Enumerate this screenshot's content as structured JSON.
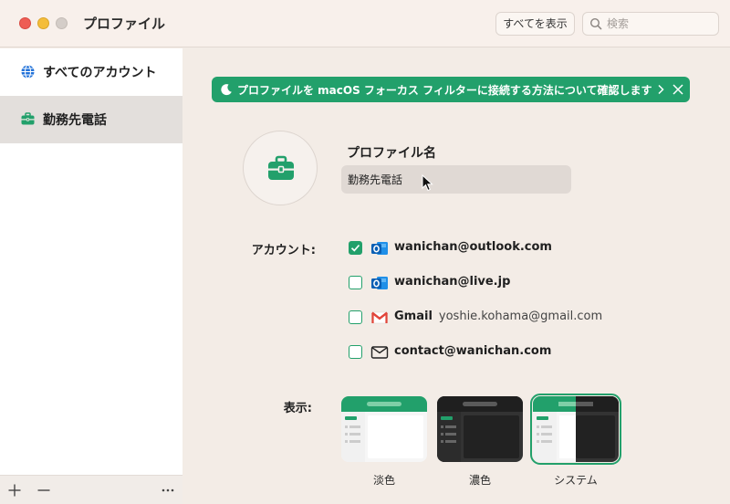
{
  "window": {
    "title": "プロファイル",
    "show_all_label": "すべてを表示",
    "search_placeholder": "検索"
  },
  "sidebar": {
    "items": [
      {
        "label": "すべてのアカウント",
        "icon": "globe-icon",
        "active": false
      },
      {
        "label": "勤務先電話",
        "icon": "briefcase-icon",
        "active": true
      }
    ],
    "footer": {
      "add_icon": "plus-icon",
      "remove_icon": "minus-icon",
      "more_icon": "ellipsis-icon"
    }
  },
  "banner": {
    "text": "プロファイルを macOS フォーカス フィルターに接続する方法について確認します",
    "color": "#22a06b"
  },
  "profile": {
    "name_label": "プロファイル名",
    "name_value": "勤務先電話"
  },
  "accounts": {
    "label": "アカウント:",
    "items": [
      {
        "email": "wanichan@outlook.com",
        "sub": "",
        "icon": "outlook-icon",
        "checked": true
      },
      {
        "email": "wanichan@live.jp",
        "sub": "",
        "icon": "outlook-icon",
        "checked": false
      },
      {
        "email": "Gmail",
        "sub": "yoshie.kohama@gmail.com",
        "icon": "gmail-icon",
        "checked": false
      },
      {
        "email": "contact@wanichan.com",
        "sub": "",
        "icon": "mail-icon",
        "checked": false
      }
    ]
  },
  "appearance": {
    "label": "表示:",
    "themes": [
      {
        "label": "淡色",
        "selected": false
      },
      {
        "label": "濃色",
        "selected": false
      },
      {
        "label": "システム",
        "selected": true
      }
    ]
  },
  "colors": {
    "accent": "#22a06b",
    "background": "#f3ece6",
    "sidebar_active": "#e3dfdc"
  }
}
